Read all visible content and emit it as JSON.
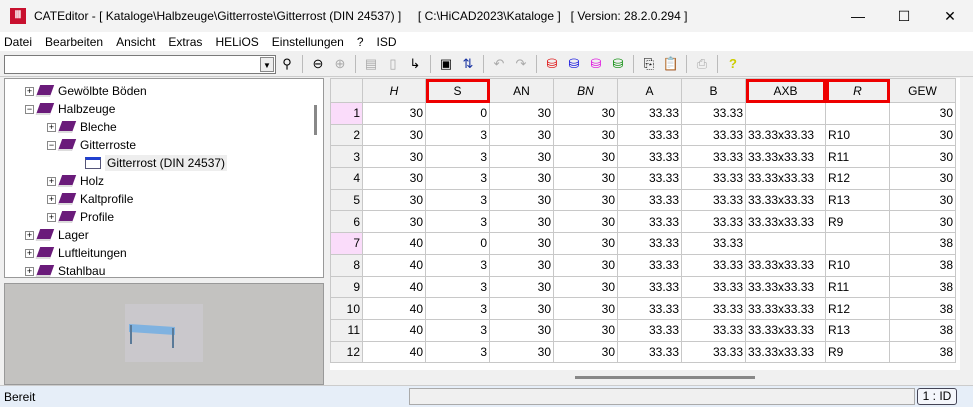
{
  "window": {
    "title": "CATEditor - [ Kataloge\\Halbzeuge\\Gitterroste\\Gitterrost (DIN 24537) ]     [ C:\\HiCAD2023\\Kataloge ]   [ Version: 28.2.0.294 ]",
    "minimize": "—",
    "maximize": "☐",
    "close": "✕"
  },
  "menu": [
    "Datei",
    "Bearbeiten",
    "Ansicht",
    "Extras",
    "HELiOS",
    "Einstellungen",
    "?",
    "ISD"
  ],
  "search": {
    "value": ""
  },
  "tree": [
    {
      "label": "Gewölbte Böden",
      "level": 1,
      "exp": "+"
    },
    {
      "label": "Halbzeuge",
      "level": 1,
      "exp": "−"
    },
    {
      "label": "Bleche",
      "level": 2,
      "exp": "+"
    },
    {
      "label": "Gitterroste",
      "level": 2,
      "exp": "−"
    },
    {
      "label": "Gitterrost (DIN 24537)",
      "level": 3,
      "exp": ""
    },
    {
      "label": "Holz",
      "level": 2,
      "exp": "+"
    },
    {
      "label": "Kaltprofile",
      "level": 2,
      "exp": "+"
    },
    {
      "label": "Profile",
      "level": 2,
      "exp": "+"
    },
    {
      "label": "Lager",
      "level": 1,
      "exp": "+"
    },
    {
      "label": "Luftleitungen",
      "level": 1,
      "exp": "+"
    },
    {
      "label": "Stahlbau",
      "level": 1,
      "exp": "+"
    }
  ],
  "table": {
    "columns": [
      "H",
      "S",
      "AN",
      "BN",
      "A",
      "B",
      "AXB",
      "R",
      "GEW"
    ],
    "rows": [
      [
        "1",
        "30",
        "0",
        "30",
        "30",
        "33.33",
        "33.33",
        "",
        "",
        "30"
      ],
      [
        "2",
        "30",
        "3",
        "30",
        "30",
        "33.33",
        "33.33",
        "33.33x33.33",
        "R10",
        "30"
      ],
      [
        "3",
        "30",
        "3",
        "30",
        "30",
        "33.33",
        "33.33",
        "33.33x33.33",
        "R11",
        "30"
      ],
      [
        "4",
        "30",
        "3",
        "30",
        "30",
        "33.33",
        "33.33",
        "33.33x33.33",
        "R12",
        "30"
      ],
      [
        "5",
        "30",
        "3",
        "30",
        "30",
        "33.33",
        "33.33",
        "33.33x33.33",
        "R13",
        "30"
      ],
      [
        "6",
        "30",
        "3",
        "30",
        "30",
        "33.33",
        "33.33",
        "33.33x33.33",
        "R9",
        "30"
      ],
      [
        "7",
        "40",
        "0",
        "30",
        "30",
        "33.33",
        "33.33",
        "",
        "",
        "38"
      ],
      [
        "8",
        "40",
        "3",
        "30",
        "30",
        "33.33",
        "33.33",
        "33.33x33.33",
        "R10",
        "38"
      ],
      [
        "9",
        "40",
        "3",
        "30",
        "30",
        "33.33",
        "33.33",
        "33.33x33.33",
        "R11",
        "38"
      ],
      [
        "10",
        "40",
        "3",
        "30",
        "30",
        "33.33",
        "33.33",
        "33.33x33.33",
        "R12",
        "38"
      ],
      [
        "11",
        "40",
        "3",
        "30",
        "30",
        "33.33",
        "33.33",
        "33.33x33.33",
        "R13",
        "38"
      ],
      [
        "12",
        "40",
        "3",
        "30",
        "30",
        "33.33",
        "33.33",
        "33.33x33.33",
        "R9",
        "38"
      ]
    ]
  },
  "status": {
    "text": "Bereit",
    "mode": "1 : ID"
  }
}
